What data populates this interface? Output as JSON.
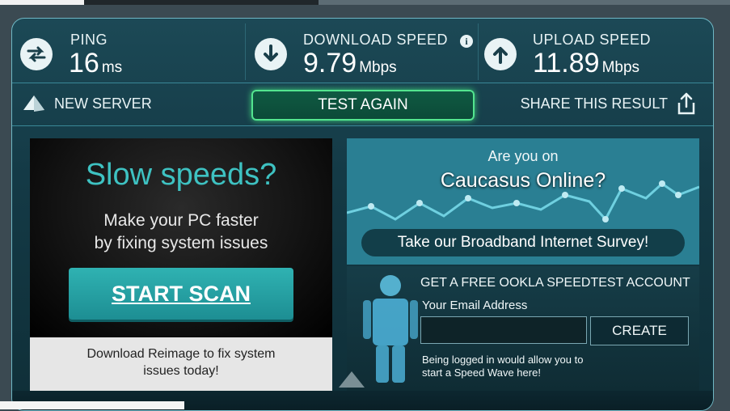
{
  "stats": {
    "ping": {
      "label": "PING",
      "value": "16",
      "unit": "ms",
      "icon": "ping-arrows-icon"
    },
    "download": {
      "label": "DOWNLOAD SPEED",
      "value": "9.79",
      "unit": "Mbps",
      "icon": "download-arrow-icon",
      "info_icon": "i"
    },
    "upload": {
      "label": "UPLOAD SPEED",
      "value": "11.89",
      "unit": "Mbps",
      "icon": "upload-arrow-icon"
    }
  },
  "actions": {
    "new_server": "NEW SERVER",
    "test_again": "TEST AGAIN",
    "share": "SHARE THIS RESULT"
  },
  "ad": {
    "headline": "Slow speeds?",
    "sub_line1": "Make your PC faster",
    "sub_line2": "by fixing system issues",
    "button": "START SCAN",
    "footer_line1": "Download Reimage to fix system",
    "footer_line2": "issues today!"
  },
  "survey": {
    "question_line1": "Are you on",
    "question_line2": "Caucasus Online?",
    "button": "Take our Broadband Internet Survey!"
  },
  "account": {
    "title": "GET A FREE OOKLA SPEEDTEST ACCOUNT",
    "email_label": "Your Email Address",
    "email_value": "",
    "create_button": "CREATE",
    "note_line1": "Being logged in would allow you to",
    "note_line2": "start a Speed Wave here!"
  },
  "colors": {
    "accent_green": "#53e58f",
    "ad_teal": "#3ec2c2",
    "panel_bg": "#1c4956"
  }
}
